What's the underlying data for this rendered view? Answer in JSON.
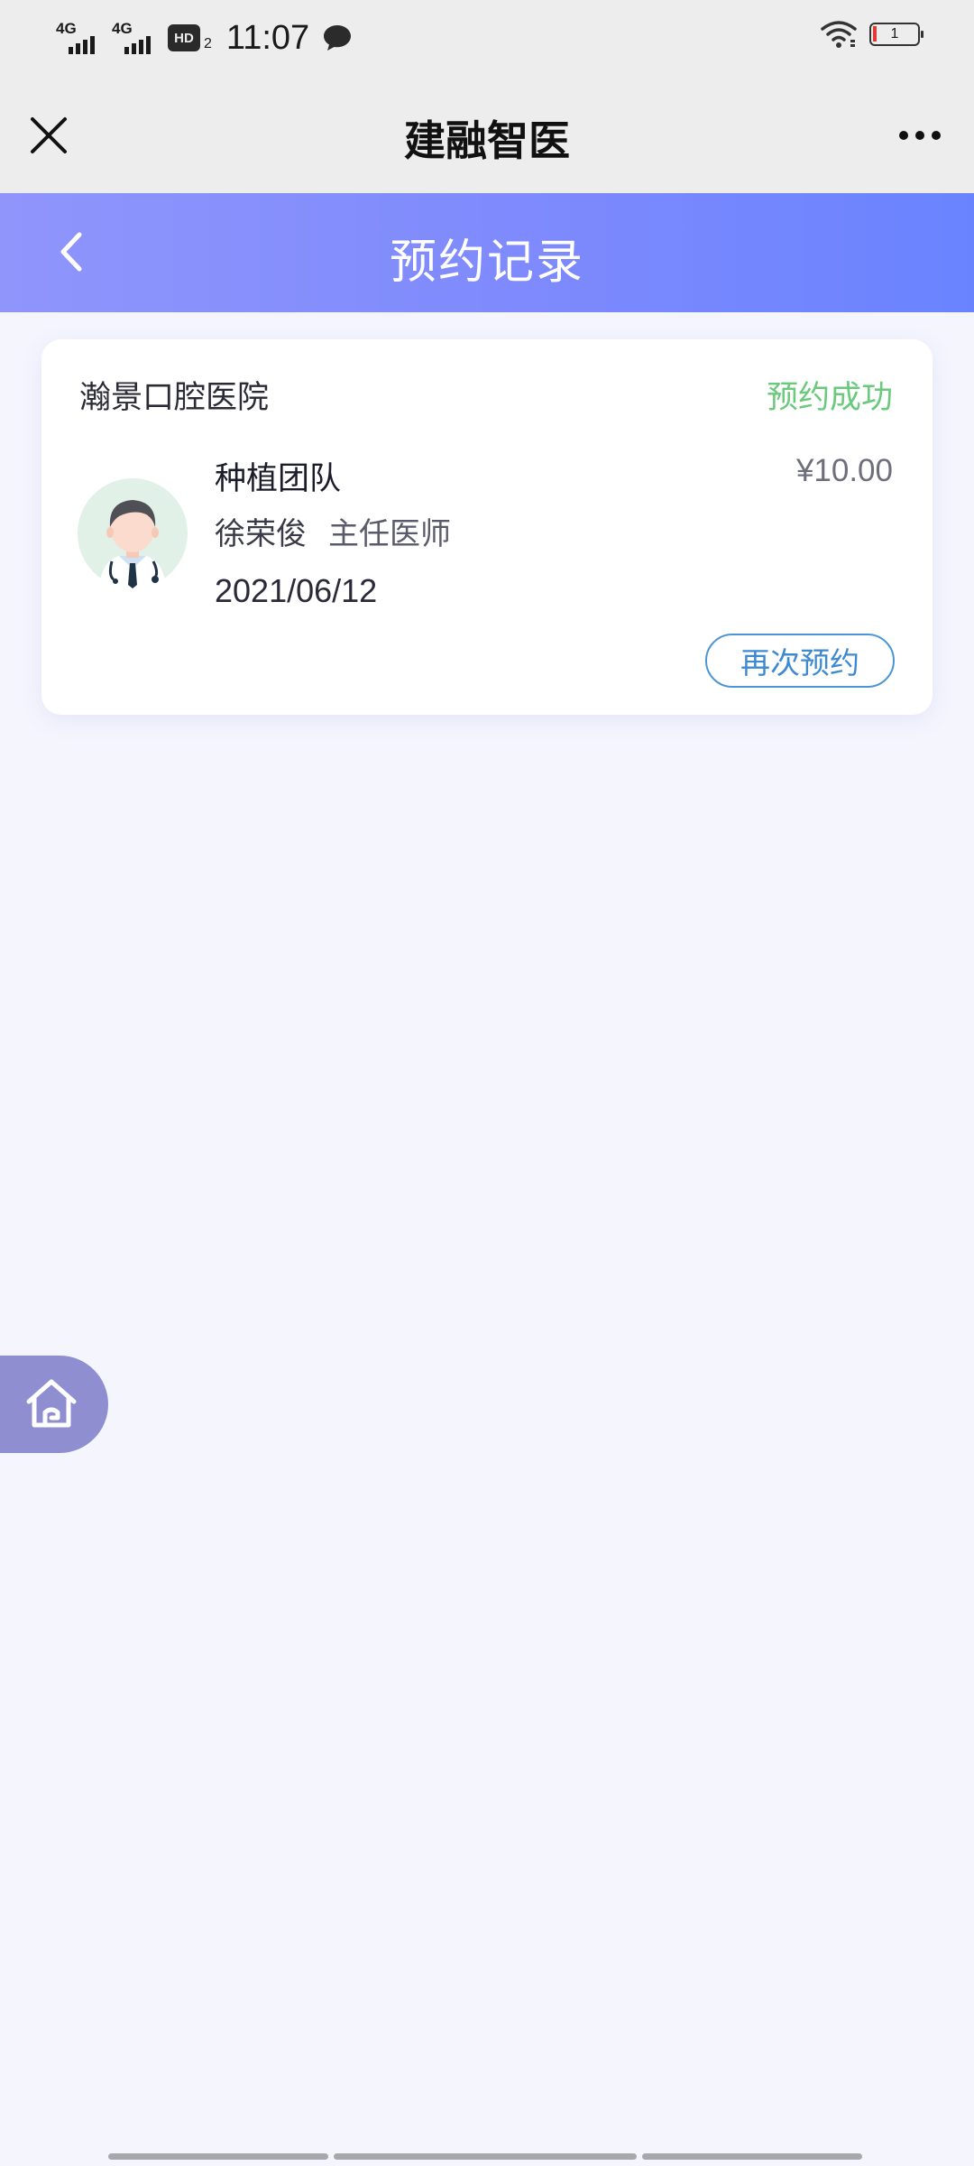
{
  "status_bar": {
    "network_1": "4G",
    "network_2": "4G",
    "hd_badge": "HD",
    "hd_sub": "2",
    "time": "11:07",
    "battery_level": "1",
    "icons": [
      "signal-icon",
      "signal-icon",
      "hd-icon",
      "chat-icon",
      "wifi-icon",
      "battery-icon"
    ]
  },
  "title_bar": {
    "title": "建融智医",
    "close_icon": "close-icon",
    "more_icon": "more-icon"
  },
  "header": {
    "title": "预约记录",
    "back_icon": "chevron-left-icon"
  },
  "appointment": {
    "hospital": "瀚景口腔医院",
    "status": "预约成功",
    "department": "种植团队",
    "price": "¥10.00",
    "doctor_name": "徐荣俊",
    "doctor_title": "主任医师",
    "date": "2021/06/12",
    "rebook_label": "再次预约",
    "avatar_icon": "doctor-avatar-icon"
  },
  "floating_home": {
    "icon": "home-icon"
  },
  "colors": {
    "header_gradient_start": "#8f95fb",
    "header_gradient_end": "#6983ff",
    "status_success": "#6ac97c",
    "rebook_accent": "#3e8ad0",
    "page_background": "#f4f5fd",
    "home_fab": "#8e8ed0"
  }
}
